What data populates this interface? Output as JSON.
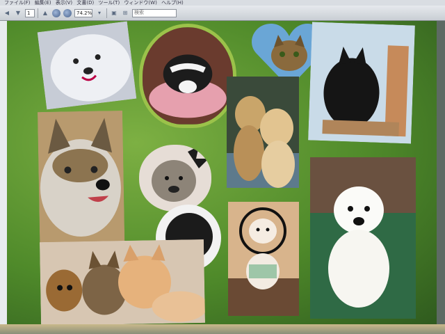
{
  "menubar": {
    "items": [
      "ファイル(F)",
      "編集(E)",
      "表示(V)",
      "文書(D)",
      "ツール(T)",
      "ウィンドウ(W)",
      "ヘルプ(H)"
    ]
  },
  "toolbar": {
    "page_number": "1",
    "zoom": "74.2%",
    "search_placeholder": "検索"
  },
  "photos": [
    {
      "name": "white-spitz"
    },
    {
      "name": "black-white-dog-apple-frame"
    },
    {
      "name": "tabby-cat-heart"
    },
    {
      "name": "black-cat"
    },
    {
      "name": "husky-mix"
    },
    {
      "name": "two-golden-retrievers"
    },
    {
      "name": "grey-poodle-speech-bubble"
    },
    {
      "name": "black-poodle-bubble"
    },
    {
      "name": "white-dog-cone"
    },
    {
      "name": "white-puppy"
    },
    {
      "name": "cats-and-chihuahua"
    }
  ]
}
